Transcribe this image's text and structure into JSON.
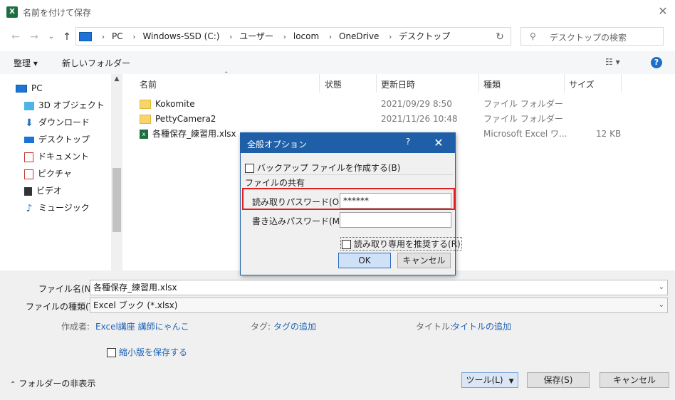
{
  "window": {
    "title": "名前を付けて保存",
    "app_icon": "X",
    "close": "✕"
  },
  "nav": {
    "back": "←",
    "forward": "→",
    "recent": "⌄",
    "up": "↑"
  },
  "address": {
    "crumbs": [
      "PC",
      "Windows-SSD (C:)",
      "ユーザー",
      "locom",
      "OneDrive",
      "デスクトップ"
    ],
    "refresh": "↻"
  },
  "search": {
    "placeholder": "デスクトップの検索"
  },
  "toolbar": {
    "organize": "整理 ▾",
    "new_folder": "新しいフォルダー",
    "view": "☷ ▾",
    "help": "?"
  },
  "sidebar": {
    "items": [
      {
        "label": "PC"
      },
      {
        "label": "3D オブジェクト"
      },
      {
        "label": "ダウンロード"
      },
      {
        "label": "デスクトップ"
      },
      {
        "label": "ドキュメント"
      },
      {
        "label": "ピクチャ"
      },
      {
        "label": "ビデオ"
      },
      {
        "label": "ミュージック"
      }
    ]
  },
  "file_list": {
    "columns": {
      "name": "名前",
      "status": "状態",
      "date": "更新日時",
      "type": "種類",
      "size": "サイズ"
    },
    "rows": [
      {
        "name": "Kokomite",
        "date": "2021/09/29 8:50",
        "type": "ファイル フォルダー",
        "size": ""
      },
      {
        "name": "PettyCamera2",
        "date": "2021/11/26 10:48",
        "type": "ファイル フォルダー",
        "size": ""
      },
      {
        "name": "各種保存_練習用.xlsx",
        "date": "",
        "type": "Microsoft Excel ワ...",
        "size": "12 KB"
      }
    ]
  },
  "save_form": {
    "filename_label": "ファイル名(N):",
    "filename_value": "各種保存_練習用.xlsx",
    "filetype_label": "ファイルの種類(T):",
    "filetype_value": "Excel ブック (*.xlsx)",
    "author_label": "作成者:",
    "author_value": "Excel講座 講師にゃんこ",
    "tag_label": "タグ:",
    "tag_value": "タグの追加",
    "title_label": "タイトル:",
    "title_value": "タイトルの追加",
    "thumbnail_label": "縮小版を保存する",
    "hide_folders": "フォルダーの非表示",
    "tools": "ツール(L)",
    "save": "保存(S)",
    "cancel": "キャンセル"
  },
  "dialog": {
    "title": "全般オプション",
    "help": "?",
    "close": "✕",
    "backup_label": "バックアップ ファイルを作成する(B)",
    "sharing_heading": "ファイルの共有",
    "read_password_label": "読み取りパスワード(O):",
    "read_password_value": "******",
    "write_password_label": "書き込みパスワード(M):",
    "write_password_value": "",
    "recommend_readonly": "読み取り専用を推奨する(R)",
    "ok": "OK",
    "cancel": "キャンセル"
  }
}
